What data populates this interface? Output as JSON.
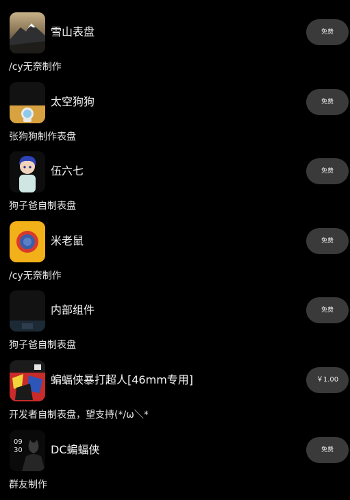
{
  "items": [
    {
      "icon": "snow-mountain-watchface-thumbnail",
      "title": "雪山表盘",
      "author": "/cy无奈制作",
      "price": "免费"
    },
    {
      "icon": "space-dog-watchface-thumbnail",
      "title": "太空狗狗",
      "author": "张狗狗制作表盘",
      "price": "免费"
    },
    {
      "icon": "anime-boy-watchface-thumbnail",
      "title": "伍六七",
      "author": "狗子爸自制表盘",
      "price": "免费"
    },
    {
      "icon": "mickey-mouse-watchface-thumbnail",
      "title": "米老鼠",
      "author": "/cy无奈制作",
      "price": "免费"
    },
    {
      "icon": "internal-widget-watchface-thumbnail",
      "title": "内部组件",
      "author": "狗子爸自制表盘",
      "price": "免费"
    },
    {
      "icon": "batman-comic-watchface-thumbnail",
      "title": "蝙蝠侠暴打超人[46mm专用]",
      "author": "开发者自制表盘，望支持(*/ω＼*",
      "price": "￥1.00"
    },
    {
      "icon": "dc-batman-watchface-thumbnail",
      "title": "DC蝙蝠侠",
      "author": "群友制作",
      "price": "免费",
      "thumb_time": [
        "09",
        "30"
      ]
    }
  ]
}
